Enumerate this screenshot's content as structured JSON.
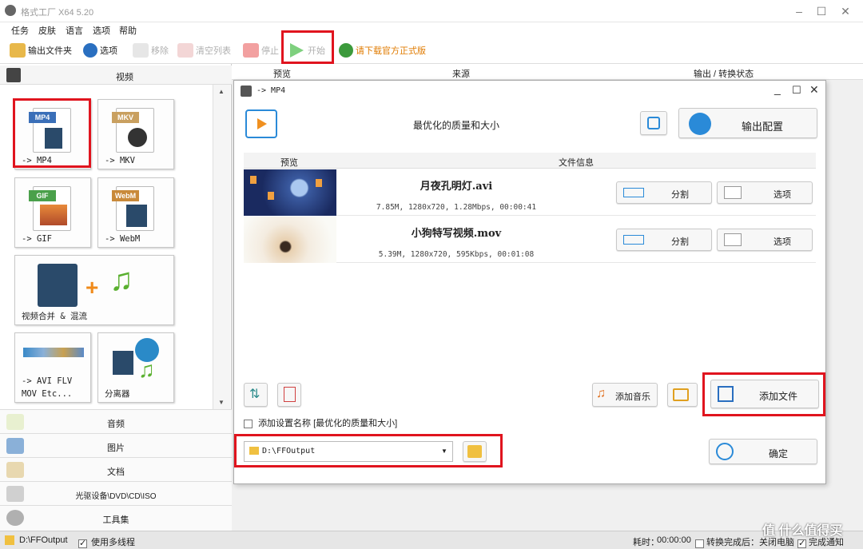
{
  "window": {
    "title": "格式工厂 X64 5.20"
  },
  "menu": [
    "任务",
    "皮肤",
    "语言",
    "选项",
    "帮助"
  ],
  "toolbar": {
    "output_folder": "输出文件夹",
    "options": "选项",
    "remove": "移除",
    "clear_list": "清空列表",
    "stop": "停止",
    "start": "开始",
    "download": "请下载官方正式版"
  },
  "sidebar": {
    "category_video": "视频",
    "tiles": {
      "mp4": "-> MP4",
      "mp4_tag": "MP4",
      "mkv": "-> MKV",
      "mkv_tag": "MKV",
      "gif": "-> GIF",
      "gif_tag": "GIF",
      "webm": "-> WebM",
      "webm_tag": "WebM",
      "merge": "视频合并 & 混流",
      "avi": "-> AVI FLV\nMOV Etc...",
      "splitter": "分离器"
    },
    "categories": [
      "音频",
      "图片",
      "文档",
      "光驱设备\\DVD\\CD\\ISO",
      "工具集"
    ]
  },
  "list_header": {
    "preview": "预览",
    "source": "来源",
    "output_status": "输出 / 转换状态"
  },
  "dialog": {
    "title": "-> MP4",
    "quality": "最优化的质量和大小",
    "output_config": "输出配置",
    "col_preview": "预览",
    "col_fileinfo": "文件信息",
    "files": [
      {
        "name": "月夜孔明灯.avi",
        "info": "7.85M, 1280x720, 1.28Mbps, 00:00:41",
        "split": "分割",
        "options": "选项"
      },
      {
        "name": "小狗特写视频.mov",
        "info": "5.39M, 1280x720, 595Kbps, 00:01:08",
        "split": "分割",
        "options": "选项"
      }
    ],
    "add_music": "添加音乐",
    "add_file": "添加文件",
    "add_setting_name": "添加设置名称 [最优化的质量和大小]",
    "output_path": "D:\\FFOutput",
    "ok": "确定"
  },
  "statusbar": {
    "path": "D:\\FFOutput",
    "multithread": "使用多线程",
    "elapsed_label": "耗时：",
    "elapsed": "00:00:00",
    "after_convert": "转换完成后：",
    "shutdown": "关闭电脑",
    "complete_notify": "完成通知"
  },
  "watermark": "值 什么值得买",
  "colors": {
    "red_highlight": "#e0141e",
    "accent_blue": "#2a8ad8"
  }
}
